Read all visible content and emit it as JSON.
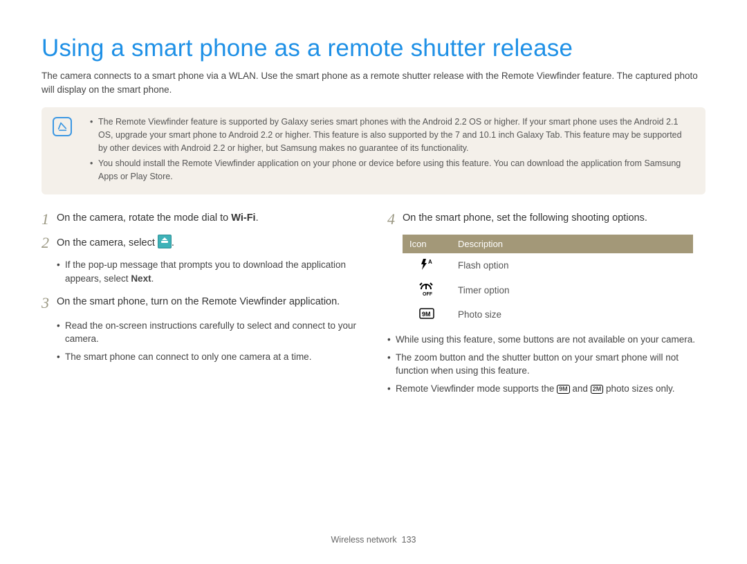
{
  "title": "Using a smart phone as a remote shutter release",
  "intro": "The camera connects to a smart phone via a WLAN. Use the smart phone as a remote shutter release with the Remote Viewfinder feature. The captured photo will display on the smart phone.",
  "notes": {
    "items": [
      "The Remote Viewfinder feature is supported by Galaxy series smart phones with the Android 2.2 OS or higher. If your smart phone uses the Android 2.1 OS, upgrade your smart phone to Android 2.2 or higher. This feature is also supported by the 7 and 10.1 inch Galaxy Tab. This feature may be supported by other devices with Android 2.2 or higher, but Samsung makes no guarantee of its functionality.",
      "You should install the Remote Viewfinder application on your phone or device before using this feature. You can download the application from Samsung Apps or Play Store."
    ]
  },
  "left": {
    "step1_pre": "On the camera, rotate the mode dial to ",
    "step1_wifi": "Wi-Fi",
    "step1_post": ".",
    "step2_pre": "On the camera, select ",
    "step2_post": ".",
    "step2_sub_pre": "If the pop-up message that prompts you to download the application appears, select ",
    "step2_sub_bold": "Next",
    "step2_sub_post": ".",
    "step3": "On the smart phone, turn on the Remote Viewfinder application.",
    "step3_subs": [
      "Read the on-screen instructions carefully to select and connect to your camera.",
      "The smart phone can connect to only one camera at a time."
    ]
  },
  "right": {
    "step4": "On the smart phone, set the following shooting options.",
    "table": {
      "h1": "Icon",
      "h2": "Description",
      "r1": "Flash option",
      "r2": "Timer option",
      "r3": "Photo size"
    },
    "bullets_a": "While using this feature, some buttons are not available on your camera.",
    "bullets_b": "The zoom button and the shutter button on your smart phone will not function when using this feature.",
    "bullets_c_pre": "Remote Viewfinder mode supports the ",
    "bullets_c_mid": " and ",
    "bullets_c_post": " photo sizes only.",
    "badge1": "9M",
    "badge2": "2M"
  },
  "footer": {
    "section": "Wireless network",
    "page": "133"
  },
  "nums": {
    "n1": "1",
    "n2": "2",
    "n3": "3",
    "n4": "4"
  }
}
